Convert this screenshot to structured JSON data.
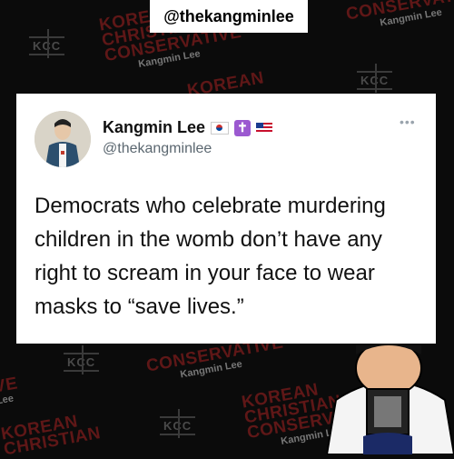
{
  "watermarks": [
    {
      "big": [
        "KOREAN",
        "CHRISTIAN",
        "CONSERVATIVE"
      ],
      "small": "Kangmin Lee"
    },
    {
      "big": [
        "KOREAN"
      ],
      "small": ""
    },
    {
      "big": [
        "CONSERVATIVE"
      ],
      "small": "Kangmin Lee"
    },
    {
      "big": [
        "KOREAN",
        "CHRISTIAN",
        "CONSERVATIVE"
      ],
      "small": "Kangmin Lee"
    },
    {
      "big": [
        "KOREAN",
        "CHRISTIAN"
      ],
      "small": ""
    },
    {
      "big": [
        "CONSERVATIVE"
      ],
      "small": "Kangmin Lee"
    }
  ],
  "kcc_logo_text": "KCC",
  "top_tag": {
    "handle": "@thekangminlee"
  },
  "tweet": {
    "name": "Kangmin Lee",
    "handle": "@thekangminlee",
    "more": "•••",
    "badge_cross": "✝",
    "text": "Democrats who celebrate murdering children in the womb don’t have any right to scream in your face to wear masks to “save lives.”"
  },
  "icons": [
    "korea-flag-icon",
    "cross-badge-icon",
    "us-flag-icon",
    "more-icon"
  ]
}
